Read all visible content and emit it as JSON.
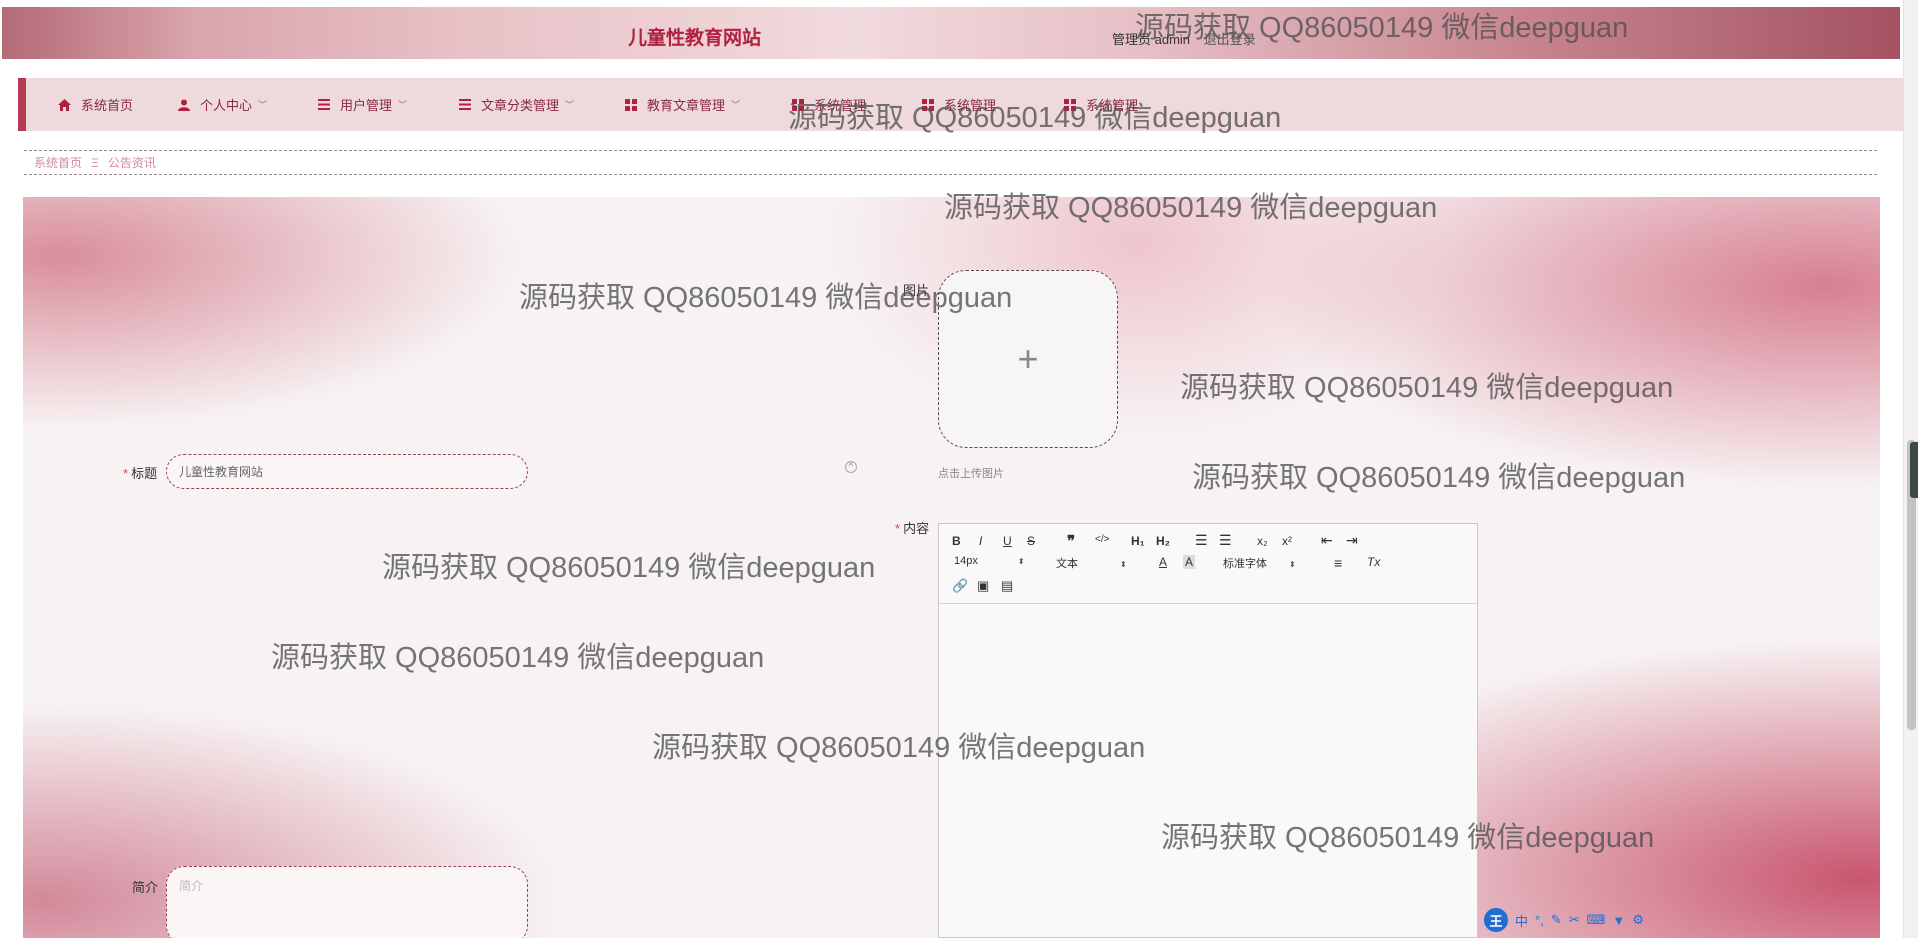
{
  "header": {
    "site_title": "儿童性教育网站",
    "admin_label": "管理员 admin",
    "logout_label": "退出登录"
  },
  "nav": {
    "items": [
      {
        "label": "系统首页",
        "icon": "home-icon",
        "has_dropdown": false
      },
      {
        "label": "个人中心",
        "icon": "user-icon",
        "has_dropdown": true
      },
      {
        "label": "用户管理",
        "icon": "list-icon",
        "has_dropdown": true
      },
      {
        "label": "文章分类管理",
        "icon": "list-icon",
        "has_dropdown": true
      },
      {
        "label": "教育文章管理",
        "icon": "grid-icon",
        "has_dropdown": true
      },
      {
        "label": "系统管理",
        "icon": "grid-icon",
        "has_dropdown": true
      },
      {
        "label": "系统管理",
        "icon": "grid-icon",
        "has_dropdown": true
      },
      {
        "label": "系统管理",
        "icon": "grid-icon",
        "has_dropdown": false
      }
    ]
  },
  "breadcrumb": {
    "home": "系统首页",
    "separator": "Ξ",
    "current": "公告资讯"
  },
  "form": {
    "title_label": "标题",
    "title_value": "儿童性教育网站",
    "image_label": "图片",
    "upload_hint": "点击上传图片",
    "content_label": "内容",
    "summary_label": "简介",
    "summary_placeholder": "简介"
  },
  "editor": {
    "font_size": "14px",
    "block_type": "文本",
    "font_family": "标准字体"
  },
  "watermark": "源码获取 QQ86050149 微信deepguan",
  "ime": {
    "logo": "王",
    "mode": "中"
  },
  "colors": {
    "accent": "#b0213f",
    "nav_bg": "#eed9dc",
    "input_border": "#a33d57"
  }
}
